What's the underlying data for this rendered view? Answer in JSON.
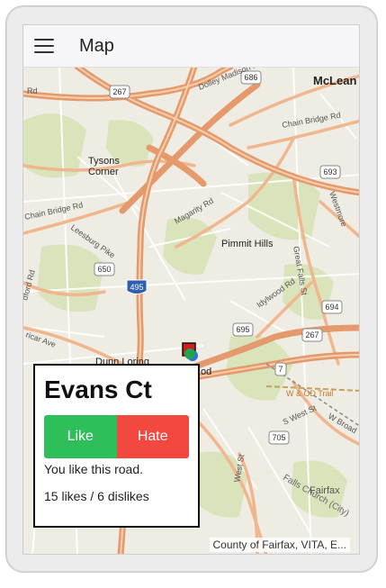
{
  "appbar": {
    "title": "Map",
    "menu_icon": "hamburger-menu-icon"
  },
  "map": {
    "labels": {
      "mclean": "McLean",
      "tysons": "Tysons",
      "corner": "Corner",
      "pimmit_hills": "Pimmit Hills",
      "dunn_loring": "Dunn Loring",
      "fairfax": "Fairfax",
      "falls_church": "Falls Church (City)",
      "wod_trail": "W & OD Trail",
      "dolley_madison": "Dolley Madison Blvd",
      "chain_bridge_top": "Chain Bridge Rd",
      "chain_bridge_left": "Chain Bridge Rd",
      "leesburg": "Leesburg Pike",
      "magarity": "Magarity Rd",
      "great_falls": "Great Falls St",
      "idylwood": "Idylwood Rd",
      "westmoreland": "Westmore",
      "w_broad": "W Broad",
      "s_west": "S West St",
      "falls_church_rd": "Falls Church",
      "rd_top": "Rd",
      "holland": "dford Rd",
      "cedar": "ricar Ave",
      "west": "West St",
      "rd_trunc": "od"
    },
    "shields": [
      "267",
      "686",
      "693",
      "650",
      "495",
      "694",
      "695",
      "267",
      "7",
      "705"
    ],
    "attribution": "County of Fairfax, VITA, E..."
  },
  "popup": {
    "road_name": "Evans Ct",
    "like_label": "Like",
    "hate_label": "Hate",
    "status": "You like this road.",
    "counts": "15 likes / 6 dislikes"
  },
  "colors": {
    "like": "#2fbf5a",
    "hate": "#f24840",
    "highway": "#e9a47c",
    "map_bg": "#efece3"
  }
}
